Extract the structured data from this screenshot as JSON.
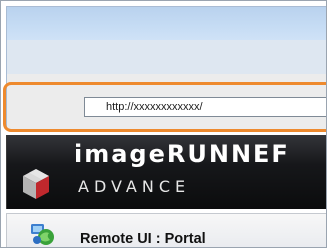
{
  "browser": {
    "address_url": "http://xxxxxxxxxxxx/"
  },
  "header": {
    "brand_name": "imageRUNNEF",
    "brand_subtitle": "ADVANCE",
    "logo_icon": "canon-cube-logo-icon"
  },
  "portal": {
    "title": "Remote UI : Portal",
    "icon": "remote-ui-portal-icon"
  },
  "colors": {
    "highlight": "#ee8a2e",
    "title_bar": "#c6dcf4",
    "header_bg": "#0b0c0d",
    "logo_red": "#c0282d"
  }
}
